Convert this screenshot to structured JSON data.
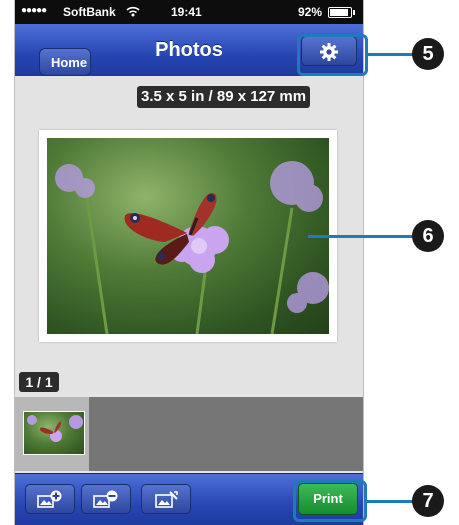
{
  "statusbar": {
    "signal": "●●●●●",
    "carrier": "SoftBank",
    "time": "19:41",
    "battery": "92%"
  },
  "navbar": {
    "home_label": "Home",
    "title": "Photos",
    "settings_icon": "gear-icon"
  },
  "preview": {
    "paper_size": "3.5 x 5 in / 89 x 127 mm",
    "page_counter": "1 / 1"
  },
  "toolbar": {
    "add_photo_icon": "add-photo-icon",
    "remove_photo_icon": "remove-photo-icon",
    "edit_photo_icon": "edit-photo-icon",
    "print_label": "Print"
  },
  "callouts": [
    "5",
    "6",
    "7"
  ],
  "colors": {
    "nav_blue": "#2746b3",
    "print_green": "#178c30",
    "callout_blue": "#1e7ab8"
  }
}
